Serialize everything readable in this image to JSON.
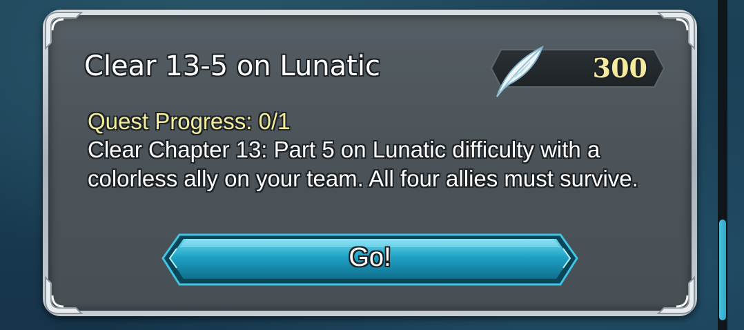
{
  "quest": {
    "title": "Clear 13-5 on Lunatic",
    "reward": {
      "icon": "feather-icon",
      "amount": "300"
    },
    "progress": "Quest Progress: 0/1",
    "description": "Clear Chapter 13: Part 5 on Lunatic difficulty with a colorless ally on your team. All four allies must survive.",
    "go_label": "Go!"
  },
  "colors": {
    "panel": "#4b5358",
    "frame": "#c6ccd1",
    "progress_text": "#f3ec9c",
    "reward_text": "#f5eaa0",
    "button": "#1fa2c4",
    "scroll_thumb": "#3cb8d6"
  }
}
